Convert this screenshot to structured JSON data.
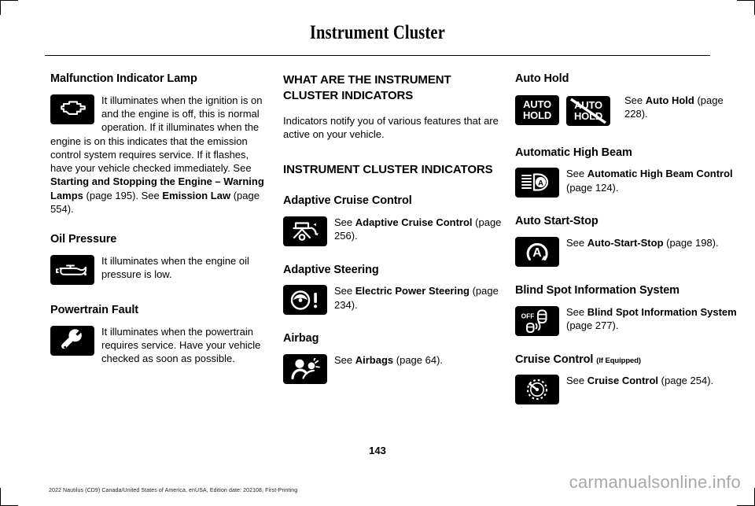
{
  "header": {
    "title": "Instrument Cluster"
  },
  "page_number": "143",
  "footer": {
    "edition_line": "2022 Nautilus (CD9) Canada/United States of America, enUSA, Edition date: 202108, First-Printing",
    "watermark": "carmanualsonline.info"
  },
  "column_left": {
    "malfunction": {
      "heading": "Malfunction Indicator Lamp",
      "icon": "engine-icon",
      "text_1": "It illuminates when the ignition is on and the engine is off, this is normal operation. If it illuminates when the engine is on this indicates that the emission control system requires service. If it flashes, have your vehicle checked immediately.  See ",
      "link_1": "Starting and Stopping the Engine – Warning Lamps",
      "text_2": " (page 195).   See ",
      "link_2": "Emission Law",
      "text_3": " (page 554)."
    },
    "oil_pressure": {
      "heading": "Oil Pressure",
      "icon": "oil-can-icon",
      "text": "It illuminates when the engine oil pressure is low."
    },
    "powertrain_fault": {
      "heading": "Powertrain Fault",
      "icon": "wrench-icon",
      "text": "It illuminates when the powertrain requires service.  Have your vehicle checked as soon as possible."
    }
  },
  "column_middle": {
    "what_are": {
      "heading": "WHAT ARE THE INSTRUMENT CLUSTER INDICATORS",
      "text": "Indicators notify you of various features that are active on your vehicle."
    },
    "indicators_heading": "INSTRUMENT CLUSTER INDICATORS",
    "adaptive_cruise": {
      "heading": "Adaptive Cruise Control",
      "icon": "adaptive-cruise-icon",
      "see": "See ",
      "link": "Adaptive Cruise Control",
      "page": " (page 256)."
    },
    "adaptive_steering": {
      "heading": "Adaptive Steering",
      "icon": "steering-wheel-warning-icon",
      "see": "See ",
      "link": "Electric Power Steering",
      "page": " (page 234)."
    },
    "airbag": {
      "heading": "Airbag",
      "icon": "airbag-icon",
      "see": "See ",
      "link": "Airbags",
      "page": " (page 64)."
    }
  },
  "column_right": {
    "auto_hold": {
      "heading": "Auto Hold",
      "icon_on": "auto-hold-badge-icon",
      "icon_off": "auto-hold-badge-off-icon",
      "badge_line_1": "AUTO",
      "badge_line_2": "HOLD",
      "see": "See ",
      "link": "Auto Hold",
      "page": " (page 228)."
    },
    "auto_high_beam": {
      "heading": "Automatic High Beam",
      "icon": "automatic-high-beam-icon",
      "badge_letter": "A",
      "see": "See ",
      "link": "Automatic High Beam Control",
      "page": " (page 124)."
    },
    "auto_start_stop": {
      "heading": "Auto Start-Stop",
      "icon": "auto-start-stop-icon",
      "badge_letter": "A",
      "see": "See ",
      "link": "Auto-Start-Stop",
      "page": " (page 198)."
    },
    "blind_spot": {
      "heading": "Blind Spot Information System",
      "icon": "blind-spot-off-icon",
      "badge_text": "OFF",
      "see": "See ",
      "link": "Blind Spot Information System",
      "page": " (page 277)."
    },
    "cruise_control": {
      "heading": "Cruise Control",
      "heading_note": "(If Equipped)",
      "icon": "speedometer-icon",
      "see": "See ",
      "link": "Cruise Control",
      "page": " (page 254)."
    }
  }
}
